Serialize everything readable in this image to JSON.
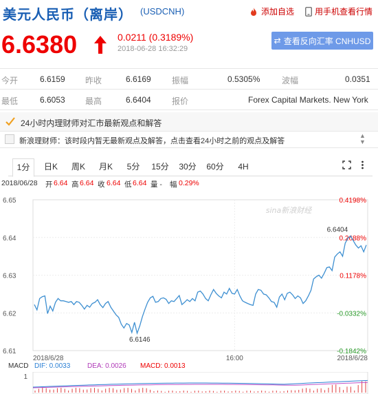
{
  "header": {
    "title": "美元人民币（离岸）",
    "code": "(USDCNH)",
    "add_fav": "添加自选",
    "mobile": "用手机查看行情"
  },
  "quote": {
    "price": "6.6380",
    "change": "0.0211 (0.3189%)",
    "time": "2018-06-28 16:32:29",
    "reverse_button": "查看反向汇率 CNHUSD"
  },
  "stats": {
    "open_label": "今开",
    "open": "6.6159",
    "prev_label": "昨收",
    "prev": "6.6169",
    "amp_label": "振幅",
    "amp": "0.5305%",
    "wave_label": "波幅",
    "wave": "0.0351",
    "low_label": "最低",
    "low": "6.6053",
    "high_label": "最高",
    "high": "6.6404",
    "quote_label": "报价",
    "quote_src": "Forex Capital Markets. New York"
  },
  "news": {
    "headline": "24小时内理财师对汇市最新观点和解答",
    "sub": "新浪理财师：该时段内暂无最新观点及解答，点击查看24小时之前的观点及解答"
  },
  "tabs": [
    "1分",
    "日K",
    "周K",
    "月K",
    "5分",
    "15分",
    "30分",
    "60分",
    "4H"
  ],
  "infoline": {
    "date": "2018/06/28",
    "open_l": "开",
    "open": "6.64",
    "high_l": "高",
    "high": "6.64",
    "close_l": "收",
    "close": "6.64",
    "low_l": "低",
    "low": "6.64",
    "vol": "量 -",
    "amp_l": "幅",
    "amp": "0.29%"
  },
  "chart_data": {
    "type": "line",
    "title": "",
    "xlabel": "",
    "ylabel": "",
    "ylim": [
      6.61,
      6.65
    ],
    "y_ticks": [
      "6.65",
      "6.64",
      "6.63",
      "6.62",
      "6.61"
    ],
    "right_ticks": [
      "0.4198%",
      "0.2688%",
      "0.1178%",
      "-0.0332%",
      "-0.1842%"
    ],
    "x_ticks": [
      "2018/6/28",
      "16:00",
      "2018/6/28"
    ],
    "grid": true,
    "watermark": "sina新浪财经",
    "annotations": [
      {
        "text": "6.6146",
        "x": 40,
        "y": 6.6146
      },
      {
        "text": "6.6404",
        "x": 119,
        "y": 6.6404
      }
    ],
    "series": [
      {
        "values": [
          6.6222,
          6.6208,
          6.6238,
          6.6243,
          6.6245,
          6.6198,
          6.6218,
          6.6205,
          6.6228,
          6.6238,
          6.6232,
          6.6232,
          6.623,
          6.6228,
          6.623,
          6.6222,
          6.623,
          6.6228,
          6.622,
          6.621,
          6.622,
          6.6215,
          6.6225,
          6.6228,
          6.6235,
          6.6222,
          6.6214,
          6.6225,
          6.623,
          6.6215,
          6.6205,
          6.6195,
          6.6188,
          6.617,
          6.616,
          6.6172,
          6.6168,
          6.6148,
          6.6175,
          6.6146,
          6.6165,
          6.619,
          6.621,
          6.6228,
          6.624,
          6.6244,
          6.6228,
          6.623,
          6.6238,
          6.624,
          6.6236,
          6.6225,
          6.6232,
          6.623,
          6.6238,
          6.6246,
          6.6222,
          6.6228,
          6.6235,
          6.623,
          6.6238,
          6.6232,
          6.6255,
          6.6258,
          6.625,
          6.6238,
          6.6232,
          6.6248,
          6.6262,
          6.6252,
          6.6245,
          6.624,
          6.6255,
          6.625,
          6.6265,
          6.6252,
          6.625,
          6.6262,
          6.6245,
          6.6232,
          6.6228,
          6.6225,
          6.6222,
          6.622,
          6.625,
          6.6262,
          6.626,
          6.625,
          6.6248,
          6.624,
          6.623,
          6.6228,
          6.6215,
          6.6242,
          6.625,
          6.6235,
          6.6252,
          6.6255,
          6.6248,
          6.6238,
          6.6245,
          6.624,
          6.6225,
          6.6232,
          6.6245,
          6.626,
          6.629,
          6.6296,
          6.63,
          6.6292,
          6.6305,
          6.632,
          6.6322,
          6.6312,
          6.6348,
          6.6356,
          6.6362,
          6.635,
          6.6385,
          6.6398,
          6.6404,
          6.6392,
          6.638,
          6.6372,
          6.6378,
          6.6362,
          6.638
        ]
      }
    ]
  },
  "macd": {
    "label": "MACD",
    "dif": "DIF: 0.0033",
    "dea": "DEA: 0.0026",
    "macd": "MACD: 0.0013",
    "axis": "1"
  },
  "colors": {
    "brand_blue": "#1a5fb4",
    "up_red": "#e00000",
    "line": "#3d8fd1",
    "button": "#6e9ae8"
  }
}
